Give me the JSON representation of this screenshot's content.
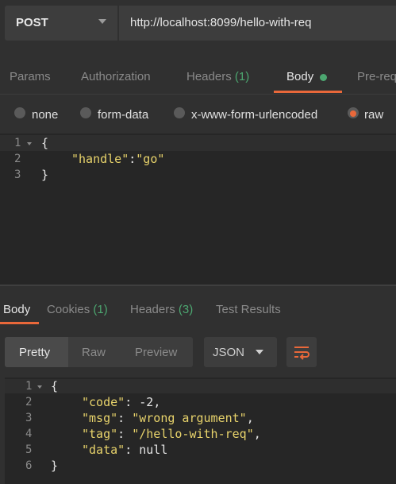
{
  "request": {
    "method": "POST",
    "url": "http://localhost:8099/hello-with-req"
  },
  "request_tabs": {
    "params": "Params",
    "authorization": "Authorization",
    "headers": "Headers",
    "headers_count": "(1)",
    "body": "Body",
    "prerequest": "Pre-req"
  },
  "body_types": {
    "none": "none",
    "form_data": "form-data",
    "urlencoded": "x-www-form-urlencoded",
    "raw": "raw"
  },
  "request_body": {
    "line_numbers": [
      "1",
      "2",
      "3"
    ],
    "open_brace": "{",
    "key": "\"handle\"",
    "colon": ":",
    "value": "\"go\"",
    "close_brace": "}"
  },
  "response_tabs": {
    "body": "Body",
    "cookies": "Cookies",
    "cookies_count": "(1)",
    "headers": "Headers",
    "headers_count": "(3)",
    "test_results": "Test Results"
  },
  "response_view": {
    "pretty": "Pretty",
    "raw": "Raw",
    "preview": "Preview",
    "format": "JSON"
  },
  "response_body": {
    "line_numbers": [
      "1",
      "2",
      "3",
      "4",
      "5",
      "6"
    ],
    "open_brace": "{",
    "code_key": "\"code\"",
    "code_value": "-2",
    "msg_key": "\"msg\"",
    "msg_value": "\"wrong argument\"",
    "tag_key": "\"tag\"",
    "tag_value": "\"/hello-with-req\"",
    "data_key": "\"data\"",
    "data_value": "null",
    "close_brace": "}"
  },
  "colors": {
    "accent": "#e9683a",
    "count_green": "#4ca670",
    "string_yellow": "#e8d36b",
    "background": "#303030",
    "editor_background": "#262626"
  }
}
